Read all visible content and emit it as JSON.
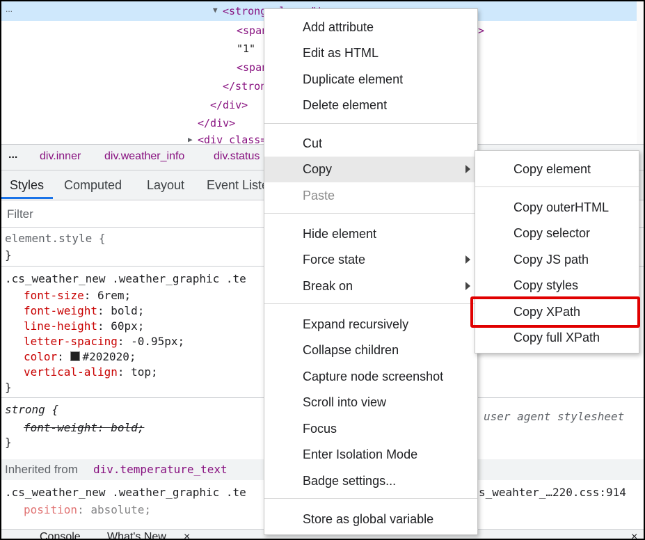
{
  "tree": {
    "lines": [
      "<strong class=\"t",
      "<span",
      "\"1\"",
      "<span",
      "</strong>",
      "</div>",
      "</div>",
      "<div class=\""
    ],
    "right_fragment": "n>",
    "collapsed_marker": "..."
  },
  "breadcrumbs": [
    "...",
    "div.inner",
    "div.weather_info",
    "div.status"
  ],
  "tabs": [
    "Styles",
    "Computed",
    "Layout",
    "Event Liste"
  ],
  "filter": {
    "placeholder": "Filter"
  },
  "styles": {
    "element_style": "element.style {",
    "close": "}",
    "rule1_selector": ".cs_weather_new .weather_graphic .te",
    "rule1_props": [
      {
        "name": "font-size",
        "value": "6rem;"
      },
      {
        "name": "font-weight",
        "value": "bold;"
      },
      {
        "name": "line-height",
        "value": "60px;"
      },
      {
        "name": "letter-spacing",
        "value": "-0.95px;"
      },
      {
        "name": "color",
        "value": "#202020;"
      },
      {
        "name": "vertical-align",
        "value": "top;"
      }
    ],
    "rule2_selector": "strong {",
    "rule2_prop": {
      "name": "font-weight",
      "value": "bold;"
    },
    "ua_label": "user agent stylesheet",
    "inherited_label": "Inherited from",
    "inherited_from": "div.temperature_text",
    "rule3_selector": ".cs_weather_new .weather_graphic .te",
    "rule3_source": "s_weahter_…220.css:914",
    "rule3_prop": {
      "name": "position",
      "value": "absolute;"
    },
    "color_swatch": "#202020"
  },
  "drawer": {
    "console": "Console",
    "whats_new": "What's New",
    "close": "×"
  },
  "context_menu": {
    "items": [
      "Add attribute",
      "Edit as HTML",
      "Duplicate element",
      "Delete element",
      "Cut",
      "Copy",
      "Paste",
      "Hide element",
      "Force state",
      "Break on",
      "Expand recursively",
      "Collapse children",
      "Capture node screenshot",
      "Scroll into view",
      "Focus",
      "Enter Isolation Mode",
      "Badge settings...",
      "Store as global variable"
    ]
  },
  "copy_submenu": {
    "items": [
      "Copy element",
      "Copy outerHTML",
      "Copy selector",
      "Copy JS path",
      "Copy styles",
      "Copy XPath",
      "Copy full XPath"
    ]
  },
  "colors": {
    "highlight_box": "#e00000",
    "selection": "#cfe8fc",
    "tag": "#881280",
    "property": "#c80000"
  }
}
